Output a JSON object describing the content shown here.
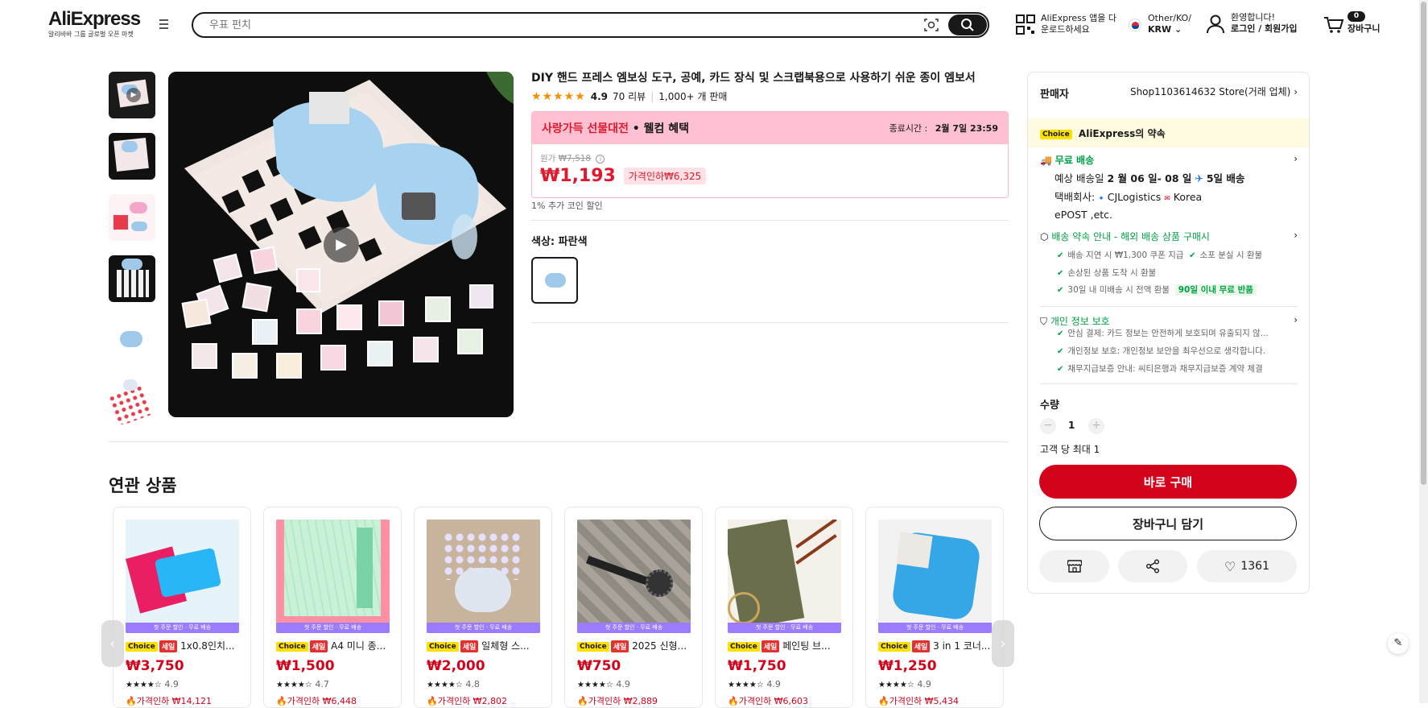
{
  "header": {
    "logo": "AliExpress",
    "logo_sub": "알리바바 그룹 글로벌 오픈 마켓",
    "search_placeholder": "우표 펀치",
    "app_line1": "AliExpress 앱을 다",
    "app_line2": "운로드하세요",
    "locale_line1": "Other/KO/",
    "locale_line2": "KRW",
    "user_line1": "환영합니다!",
    "user_line2": "로그인 / 회원가입",
    "cart_count": "0",
    "cart_label": "장바구니"
  },
  "product": {
    "title": "DIY 핸드 프레스 엠보싱 도구, 공예, 카드 장식 및 스크랩북용으로 사용하기 쉬운 종이 엠보서",
    "stars": "★★★★★",
    "rating": "4.9",
    "reviews": "70 리뷰",
    "sold": "1,000+ 개 판매",
    "promo_name": "사랑가득 선물대전",
    "promo_suffix": "• 웰컴 혜택",
    "end_label": "종료시간 :",
    "end_time": "2월 7일 23:59",
    "orig_label": "원가",
    "orig_price": "₩7,518",
    "price": "₩1,193",
    "discount": "가격인하₩6,325",
    "coin": "1% 추가 코인 할인",
    "color_label": "색상: 파란색"
  },
  "panel": {
    "seller_label": "판매자",
    "seller_name": "Shop1103614632 Store(거래 업체)",
    "choice_badge": "Choice",
    "choice_title": "AliExpress의 약속",
    "free_ship": "무료 배송",
    "delivery_prefix": "예상 배송일",
    "delivery_dates": "2 월 06 일- 08 일",
    "delivery_days": "5일 배송",
    "carrier_label": "택배회사:",
    "carrier1": "CJLogistics",
    "carrier2": "Korea",
    "carrier3": "ePOST ,etc.",
    "promise_title": "배송 약속 안내 - 해외 배송 상품 구매시",
    "promise1": "배송 지연 시 ₩1,300 쿠폰 지급",
    "promise2": "소포 분실 시 환불",
    "promise3": "손상된 상품 도착 시 환불",
    "promise4": "30일 내 미배송 시 전액 환불",
    "promise4_badge": "90일 이내 무료 반품",
    "privacy_title": "개인 정보 보호",
    "privacy1": "안심 결제: 카드 정보는 안전하게 보호되며 유출되지 않...",
    "privacy2": "개인정보 보호: 개인정보 보안을 최우선으로 생각합니다.",
    "privacy3": "채무지급보증 안내: 씨티은행과 채무지급보증 계약 체결",
    "qty_label": "수량",
    "qty_value": "1",
    "qty_max": "고객 당 최대 1",
    "buy_now": "바로 구매",
    "add_cart": "장바구니 담기",
    "likes": "1361"
  },
  "related": {
    "title": "연관 상품",
    "band": "첫 주문 할인 · 무료 배송",
    "choice": "Choice",
    "sale": "세일",
    "items": [
      {
        "name": "1x0.8인치...",
        "price": "₩3,750",
        "rating": "4.9",
        "disc": "가격인하 ₩14,121"
      },
      {
        "name": "A4 미니 종...",
        "price": "₩1,500",
        "rating": "4.7",
        "disc": "가격인하 ₩6,448"
      },
      {
        "name": "일체형 스...",
        "price": "₩2,000",
        "rating": "4.8",
        "disc": "가격인하 ₩2,802"
      },
      {
        "name": "2025 신형...",
        "price": "₩750",
        "rating": "4.9",
        "disc": "가격인하 ₩2,889"
      },
      {
        "name": "페인팅 브...",
        "price": "₩1,750",
        "rating": "4.9",
        "disc": "가격인하 ₩6,603"
      },
      {
        "name": "3 in 1 코너...",
        "price": "₩1,250",
        "rating": "4.9",
        "disc": "가격인하 ₩5,434"
      }
    ],
    "stars": "★★★★☆"
  }
}
